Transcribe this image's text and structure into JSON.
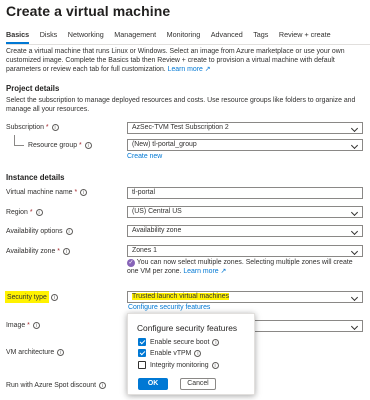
{
  "page": {
    "title": "Create a virtual machine",
    "more": "..."
  },
  "tabs": [
    {
      "label": "Basics",
      "active": true
    },
    {
      "label": "Disks"
    },
    {
      "label": "Networking"
    },
    {
      "label": "Management"
    },
    {
      "label": "Monitoring"
    },
    {
      "label": "Advanced"
    },
    {
      "label": "Tags"
    },
    {
      "label": "Review + create"
    }
  ],
  "intro": {
    "text": "Create a virtual machine that runs Linux or Windows. Select an image from Azure marketplace or use your own customized image. Complete the Basics tab then Review + create to provision a virtual machine with default parameters or review each tab for full customization.",
    "learn_more": "Learn more"
  },
  "project": {
    "heading": "Project details",
    "desc": "Select the subscription to manage deployed resources and costs. Use resource groups like folders to organize and manage all your resources.",
    "subscription_label": "Subscription",
    "subscription_value": "AzSec-TVM Test Subscription 2",
    "rg_label": "Resource group",
    "rg_value": "(New) tl-portal_group",
    "rg_create": "Create new"
  },
  "instance": {
    "heading": "Instance details",
    "vm_name_label": "Virtual machine name",
    "vm_name_value": "tl-portal",
    "region_label": "Region",
    "region_value": "(US) Central US",
    "avail_opts_label": "Availability options",
    "avail_opts_value": "Availability zone",
    "avail_zone_label": "Availability zone",
    "avail_zone_value": "Zones 1",
    "zone_note": "You can now select multiple zones. Selecting multiple zones will create one VM per zone.",
    "zone_note_link": "Learn more",
    "security_label": "Security type",
    "security_value": "Trusted launch virtual machines",
    "configure_link": "Configure security features",
    "image_label": "Image",
    "vm_arch_label": "VM architecture",
    "spot_label": "Run with Azure Spot discount"
  },
  "popup": {
    "title": "Configure security features",
    "options": [
      {
        "label": "Enable secure boot",
        "checked": true
      },
      {
        "label": "Enable vTPM",
        "checked": true
      },
      {
        "label": "Integrity monitoring",
        "checked": false
      }
    ],
    "ok": "OK",
    "cancel": "Cancel"
  },
  "icons": {
    "required": "*",
    "info": "i",
    "note": "✓"
  },
  "colors": {
    "accent": "#0078d4",
    "highlight": "#fff200",
    "note": "#8764b8"
  }
}
